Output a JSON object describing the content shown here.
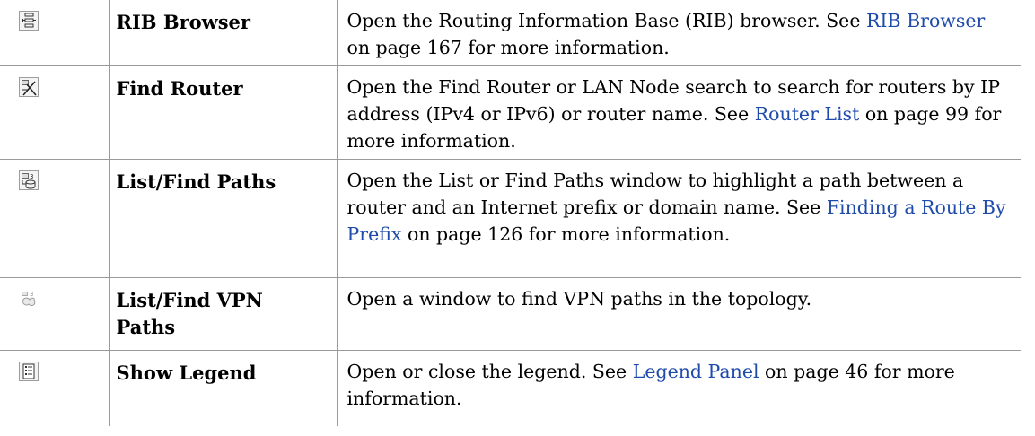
{
  "rows": [
    {
      "icon": "rib-browser-icon",
      "name": "RIB Browser",
      "pre": "Open the Routing Information Base (RIB) browser. See ",
      "link": "RIB Browser",
      "post": " on page 167 for more information."
    },
    {
      "icon": "find-router-icon",
      "name": "Find Router",
      "pre": "Open the Find Router or LAN Node search to search for routers by IP address (IPv4 or IPv6) or router name. See ",
      "link": "Router List",
      "post": " on page 99 for more information."
    },
    {
      "icon": "list-find-paths-icon",
      "name": "List/Find Paths",
      "pre": "Open the List or Find Paths window to highlight a path between a router and an Internet prefix or domain name. See ",
      "link": "Finding a Route By Prefix",
      "post": " on page 126 for more information."
    },
    {
      "icon": "list-find-vpn-paths-icon",
      "name": "List/Find VPN Paths",
      "pre": "Open a window to find VPN paths in the topology.",
      "link": "",
      "post": ""
    },
    {
      "icon": "show-legend-icon",
      "name": "Show Legend",
      "pre": "Open or close the legend. See ",
      "link": "Legend Panel",
      "post": " on page 46 for more information."
    }
  ],
  "colors": {
    "link": "#1f4bab",
    "rule": "#9a9a9a"
  }
}
